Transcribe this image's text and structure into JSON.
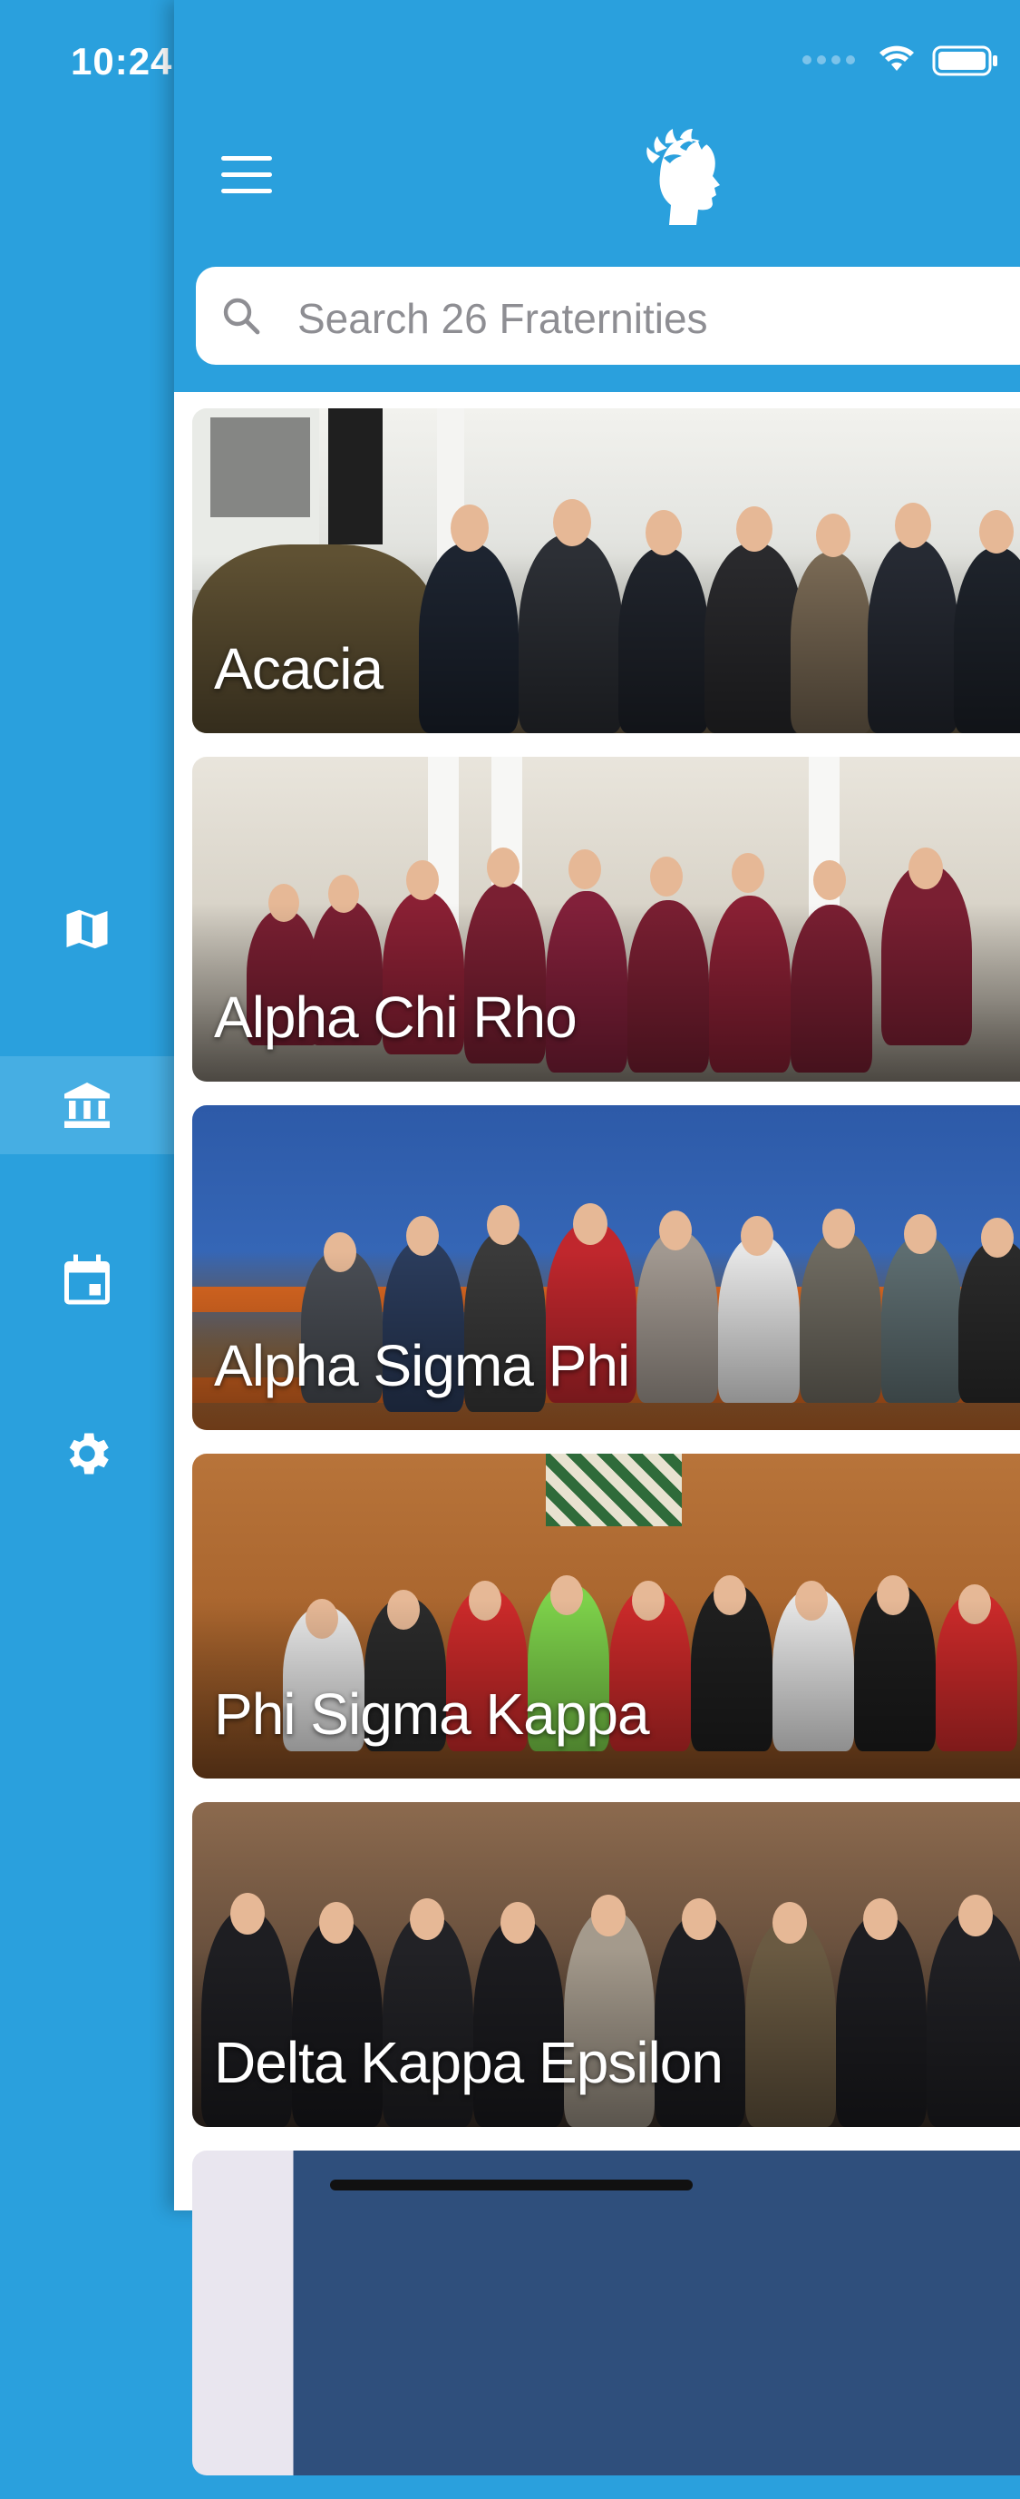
{
  "status_bar": {
    "time": "10:24"
  },
  "nav_rail": {
    "items": [
      {
        "name": "map",
        "icon": "map-icon",
        "active": false
      },
      {
        "name": "fraternities",
        "icon": "building-columns-icon",
        "active": true
      },
      {
        "name": "calendar",
        "icon": "calendar-icon",
        "active": false
      },
      {
        "name": "settings",
        "icon": "gear-icon",
        "active": false
      }
    ]
  },
  "header": {
    "menu_icon": "hamburger-menu-icon",
    "logo_icon": "laurel-head-logo-icon"
  },
  "search": {
    "placeholder": "Search 26 Fraternities"
  },
  "fraternities": [
    {
      "name": "Acacia"
    },
    {
      "name": "Alpha Chi Rho"
    },
    {
      "name": "Alpha Sigma Phi"
    },
    {
      "name": "Phi Sigma Kappa"
    },
    {
      "name": "Delta Kappa Epsilon"
    }
  ],
  "colors": {
    "brand_blue": "#2aa0dd",
    "rail_active": "#46aee3"
  }
}
